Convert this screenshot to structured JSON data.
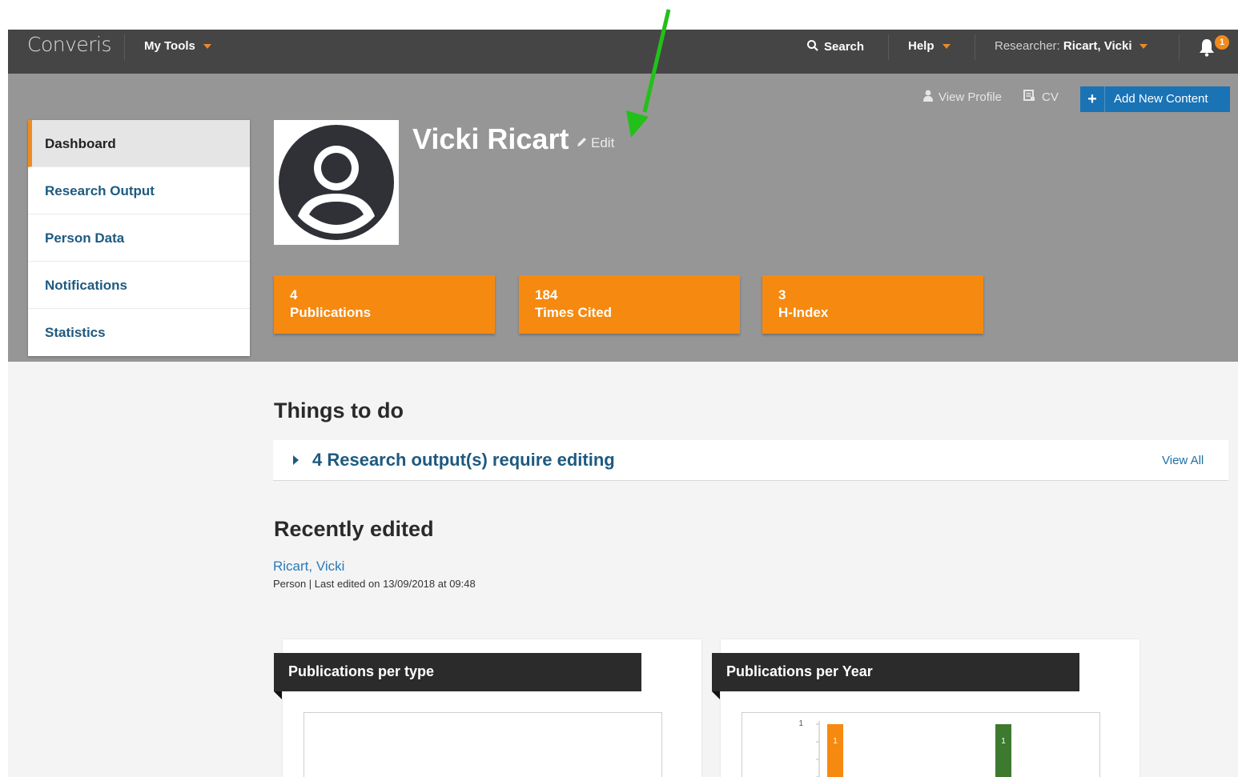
{
  "app": {
    "logo": "Converis"
  },
  "topbar": {
    "my_tools": "My Tools",
    "search": "Search",
    "help": "Help",
    "researcher_label": "Researcher:",
    "researcher_name": "Ricart, Vicki",
    "notification_count": "1"
  },
  "actions": {
    "view_profile": "View Profile",
    "cv": "CV",
    "add_new_content": "Add New Content"
  },
  "sidebar": {
    "items": [
      {
        "label": "Dashboard"
      },
      {
        "label": "Research Output"
      },
      {
        "label": "Person Data"
      },
      {
        "label": "Notifications"
      },
      {
        "label": "Statistics"
      }
    ]
  },
  "profile": {
    "name": "Vicki Ricart",
    "edit_label": "Edit"
  },
  "metrics": [
    {
      "value": "4",
      "label": "Publications"
    },
    {
      "value": "184",
      "label": "Times Cited"
    },
    {
      "value": "3",
      "label": "H-Index"
    }
  ],
  "todo": {
    "heading": "Things to do",
    "item": "4 Research output(s) require editing",
    "view_all": "View All"
  },
  "recent": {
    "heading": "Recently edited",
    "link": "Ricart, Vicki",
    "meta": "Person | Last edited on 13/09/2018 at 09:48"
  },
  "charts": {
    "per_type_title": "Publications per type",
    "per_year_title": "Publications per Year"
  },
  "chart_data": {
    "type": "bar",
    "title": "Publications per Year",
    "y_tick": "1",
    "series": [
      {
        "color": "#f6890f",
        "values": [
          1
        ],
        "data_label": "1"
      },
      {
        "color": "#3d7a2f",
        "values": [
          1
        ],
        "data_label": "1"
      }
    ]
  },
  "colors": {
    "accent_orange": "#f6890f",
    "link_blue": "#1d5a80",
    "button_blue": "#1a73b5",
    "annotation_green": "#22c01a"
  }
}
